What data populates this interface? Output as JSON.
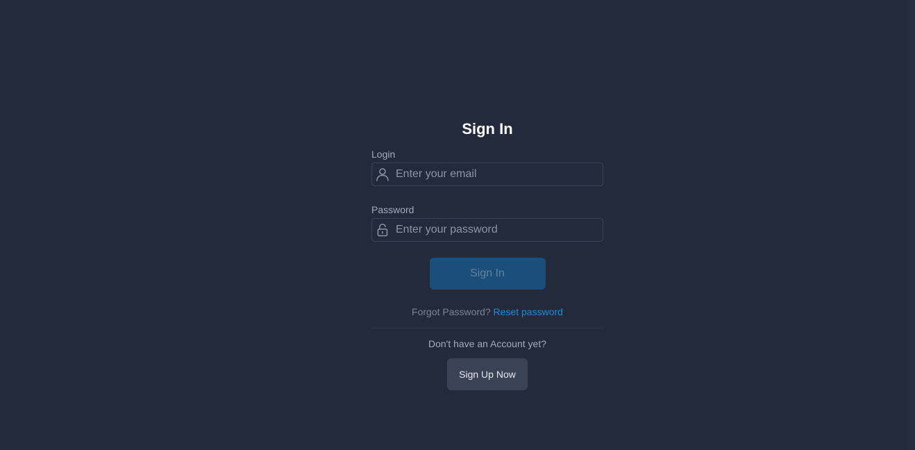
{
  "form": {
    "title": "Sign In",
    "login": {
      "label": "Login",
      "placeholder": "Enter your email",
      "value": "",
      "icon": "user-icon"
    },
    "password": {
      "label": "Password",
      "placeholder": "Enter your password",
      "value": "",
      "icon": "lock-icon"
    },
    "signin_label": "Sign In",
    "forgot_text": "Forgot Password?",
    "reset_link": "Reset password",
    "no_account_text": "Don't have an Account yet?",
    "signup_label": "Sign Up Now"
  },
  "colors": {
    "background": "#232a3b",
    "primary_button": "#1a4f7c",
    "link": "#1a8ddb",
    "secondary_button": "#3a4256"
  }
}
